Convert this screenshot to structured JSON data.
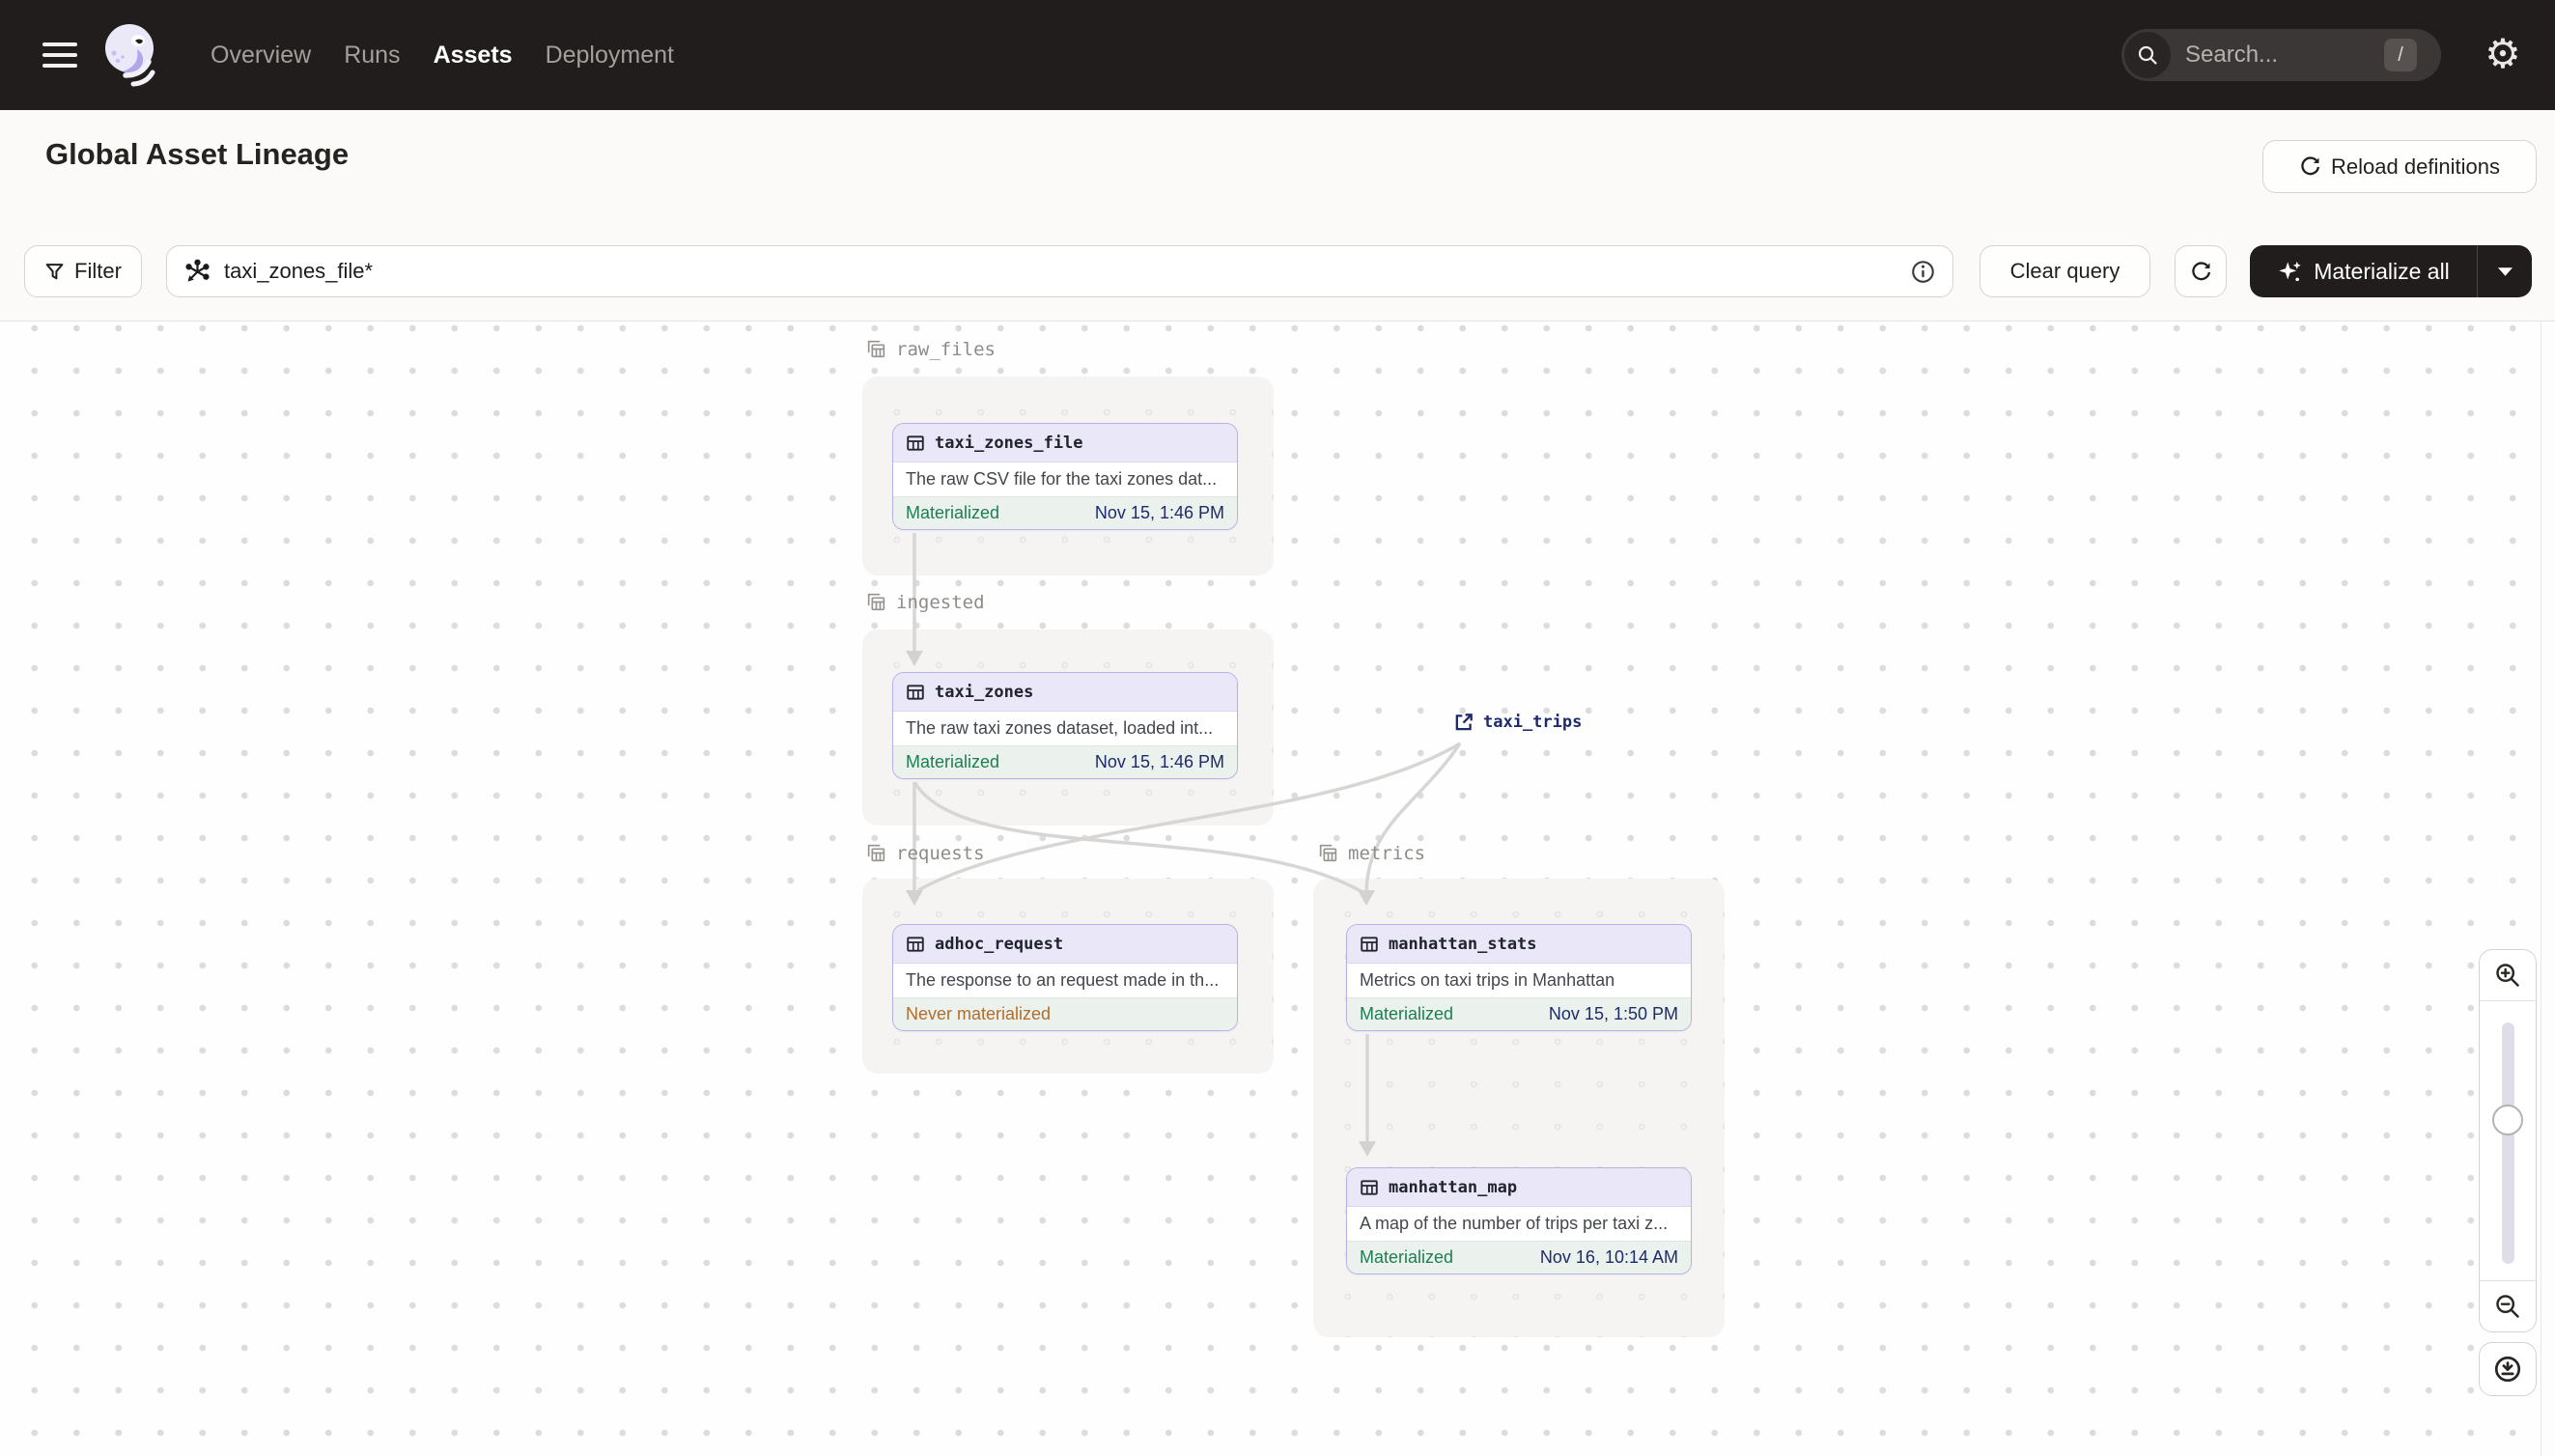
{
  "header": {
    "nav_items": [
      {
        "label": "Overview",
        "active": false
      },
      {
        "label": "Runs",
        "active": false
      },
      {
        "label": "Assets",
        "active": true
      },
      {
        "label": "Deployment",
        "active": false
      }
    ],
    "search": {
      "placeholder": "Search...",
      "shortcut": "/"
    }
  },
  "page_header": {
    "title": "Global Asset Lineage",
    "reload_button_label": "Reload definitions"
  },
  "toolbar": {
    "filter_button_label": "Filter",
    "query_input_value": "taxi_zones_file*",
    "clear_query_label": "Clear query",
    "materialize_button_label": "Materialize all"
  },
  "graph": {
    "groups": [
      {
        "name": "raw_files"
      },
      {
        "name": "ingested"
      },
      {
        "name": "requests"
      },
      {
        "name": "metrics"
      }
    ],
    "nodes": [
      {
        "id": "taxi_zones_file",
        "group": "raw_files",
        "description": "The raw CSV file for the taxi zones dat...",
        "status": "Materialized",
        "timestamp": "Nov 15, 1:46 PM"
      },
      {
        "id": "taxi_zones",
        "group": "ingested",
        "description": "The raw taxi zones dataset, loaded int...",
        "status": "Materialized",
        "timestamp": "Nov 15, 1:46 PM"
      },
      {
        "id": "adhoc_request",
        "group": "requests",
        "description": "The response to an request made in th...",
        "status": "Never materialized",
        "timestamp": ""
      },
      {
        "id": "manhattan_stats",
        "group": "metrics",
        "description": "Metrics on taxi trips in Manhattan",
        "status": "Materialized",
        "timestamp": "Nov 15, 1:50 PM"
      },
      {
        "id": "manhattan_map",
        "group": "metrics",
        "description": "A map of the number of trips per taxi z...",
        "status": "Materialized",
        "timestamp": "Nov 16, 10:14 AM"
      }
    ],
    "external_assets": [
      {
        "name": "taxi_trips"
      }
    ],
    "edges": [
      {
        "from": "taxi_zones_file",
        "to": "taxi_zones"
      },
      {
        "from": "taxi_zones",
        "to": "adhoc_request"
      },
      {
        "from": "taxi_zones",
        "to": "manhattan_stats"
      },
      {
        "from": "taxi_trips",
        "to": "adhoc_request"
      },
      {
        "from": "taxi_trips",
        "to": "manhattan_stats"
      },
      {
        "from": "manhattan_stats",
        "to": "manhattan_map"
      }
    ]
  },
  "colors": {
    "topbar_bg": "#211D1C",
    "status_materialized": "#1C7F52",
    "status_never_materialized": "#B26D2B",
    "timestamp_text": "#1E2B6B",
    "node_border": "#B7B1E6",
    "node_header_bg": "#E9E7F8",
    "edge": "#D8D6D4"
  }
}
